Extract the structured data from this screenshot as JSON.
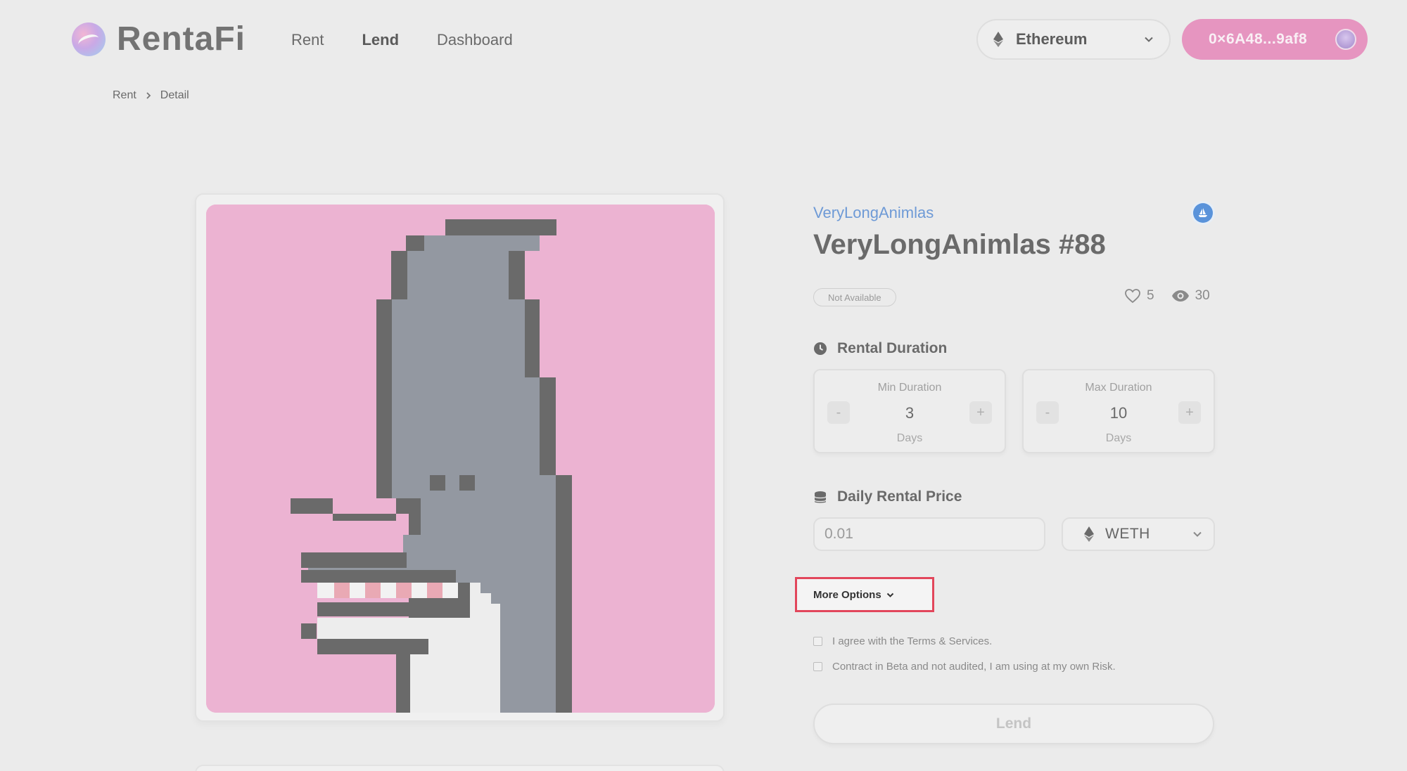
{
  "header": {
    "logo_text": "RentaFi",
    "nav": [
      {
        "label": "Rent"
      },
      {
        "label": "Lend"
      },
      {
        "label": "Dashboard"
      }
    ],
    "network": {
      "label": "Ethereum",
      "icon": "ethereum-icon"
    },
    "wallet": {
      "address": "0×6A48...9af8"
    }
  },
  "breadcrumb": {
    "items": [
      "Rent",
      "Detail"
    ],
    "separator": "›"
  },
  "nft": {
    "collection": "VeryLongAnimlas",
    "title": "VeryLongAnimlas #88",
    "status": "Not Available",
    "likes": "5",
    "views": "30",
    "image_background": "#ecb3d2"
  },
  "rental_duration": {
    "title": "Rental Duration",
    "min": {
      "label": "Min Duration",
      "value": "3",
      "unit": "Days"
    },
    "max": {
      "label": "Max Duration",
      "value": "10",
      "unit": "Days"
    },
    "minus": "-",
    "plus": "+"
  },
  "daily_price": {
    "title": "Daily Rental Price",
    "value": "0.01",
    "currency": "WETH"
  },
  "more_options": {
    "label": "More Options"
  },
  "agreements": [
    {
      "label": "I agree with the Terms & Services."
    },
    {
      "label": "Contract in Beta and not audited, I am using at my own Risk."
    }
  ],
  "lend_button": {
    "label": "Lend"
  },
  "colors": {
    "accent_pink": "#e695c0",
    "link_blue": "#6e9ad6",
    "highlight_red": "#e2465b"
  }
}
